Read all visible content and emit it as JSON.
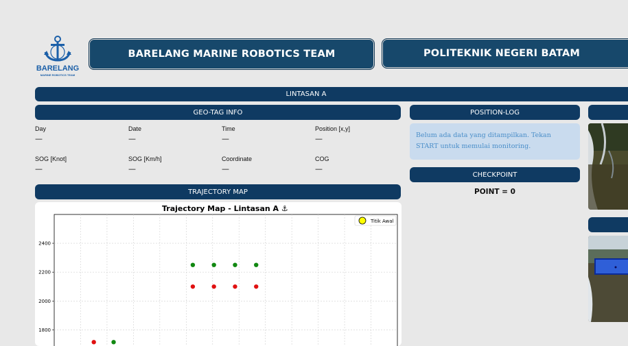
{
  "header": {
    "logo_text": "BARELANG",
    "logo_subtext": "MARINE ROBOTICS TEAM",
    "title_left": "BARELANG MARINE ROBOTICS TEAM",
    "title_right": "POLITEKNIK NEGERI BATAM",
    "track_title": "LINTASAN A"
  },
  "geotag": {
    "title": "GEO-TAG INFO",
    "fields": [
      {
        "label": "Day",
        "value": "—"
      },
      {
        "label": "Date",
        "value": "—"
      },
      {
        "label": "Time",
        "value": "—"
      },
      {
        "label": "Position [x,y]",
        "value": "—"
      },
      {
        "label": "SOG [Knot]",
        "value": "—"
      },
      {
        "label": "SOG [Km/h]",
        "value": "—"
      },
      {
        "label": "Coordinate",
        "value": "—"
      },
      {
        "label": "COG",
        "value": "—"
      }
    ]
  },
  "position_log": {
    "title": "POSITION-LOG",
    "message": "Belum ada data yang ditampilkan. Tekan START untuk memulai monitoring."
  },
  "checkpoint": {
    "title": "CHECKPOINT",
    "point_text": "POINT = 0"
  },
  "trajectory": {
    "title": "TRAJECTORY MAP"
  },
  "colors": {
    "header_bg": "#17486b",
    "bar_bg": "#0f3a62",
    "info_bg": "#c9dbee",
    "info_text": "#4a8ec9",
    "red_marker": "#e01010",
    "green_marker": "#118811",
    "start_marker": "#ffff00"
  },
  "chart_data": {
    "type": "scatter",
    "title": "Trajectory Map - Lintasan A ⚓",
    "xlabel": "",
    "ylabel": "",
    "ylim": [
      1650,
      2600
    ],
    "xlim": [
      0,
      2600
    ],
    "y_ticks": [
      1800,
      2000,
      2200,
      2400
    ],
    "grid": true,
    "legend": {
      "position": "top-right",
      "entries": [
        "Titik Awal"
      ]
    },
    "series": [
      {
        "color": "red",
        "x": [
          300,
          1050,
          1210,
          1370,
          1530
        ],
        "y": [
          1715,
          2100,
          2100,
          2100,
          2100
        ]
      },
      {
        "color": "green",
        "x": [
          450,
          1050,
          1210,
          1370,
          1530
        ],
        "y": [
          1715,
          2250,
          2250,
          2250,
          2250
        ]
      }
    ]
  }
}
